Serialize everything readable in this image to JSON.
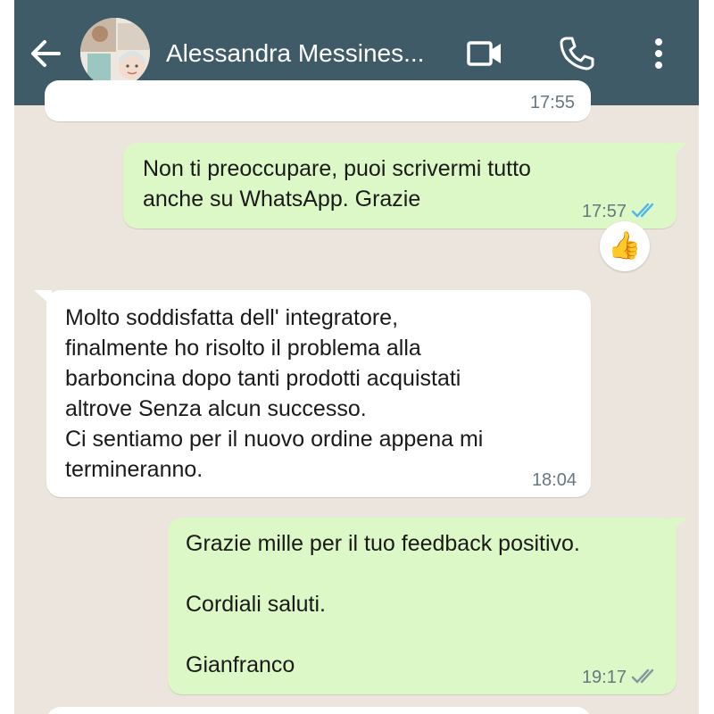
{
  "header": {
    "contact_name": "Alessandra Messines...",
    "back_icon": "arrow-left-icon",
    "video_icon": "videocam-icon",
    "call_icon": "phone-icon",
    "menu_icon": "more-vert-icon"
  },
  "messages": [
    {
      "direction": "incoming",
      "text": "",
      "time": "17:55"
    },
    {
      "direction": "outgoing",
      "text": "Non ti preoccupare, puoi scrivermi tutto\nanche su WhatsApp. Grazie",
      "time": "17:57",
      "status": "read",
      "reaction": "👍"
    },
    {
      "direction": "incoming",
      "text": "Molto soddisfatta dell' integratore,\nfinalmente ho risolto il problema alla\nbarboncina dopo tanti prodotti acquistati\naltrove Senza alcun successo.\nCi sentiamo per il nuovo ordine appena mi\ntermineranno.",
      "time": "18:04"
    },
    {
      "direction": "outgoing",
      "text": "Grazie mille per il tuo feedback positivo.\n\nCordiali saluti.\n\nGianfranco",
      "time": "19:17",
      "status": "delivered"
    }
  ],
  "colors": {
    "header": "#3f5b68",
    "chat_background": "#ece5dd",
    "outgoing_bubble": "#dcf8c6",
    "incoming_bubble": "#ffffff",
    "read_tick": "#4fb6ec",
    "sent_tick": "#8696a0"
  }
}
